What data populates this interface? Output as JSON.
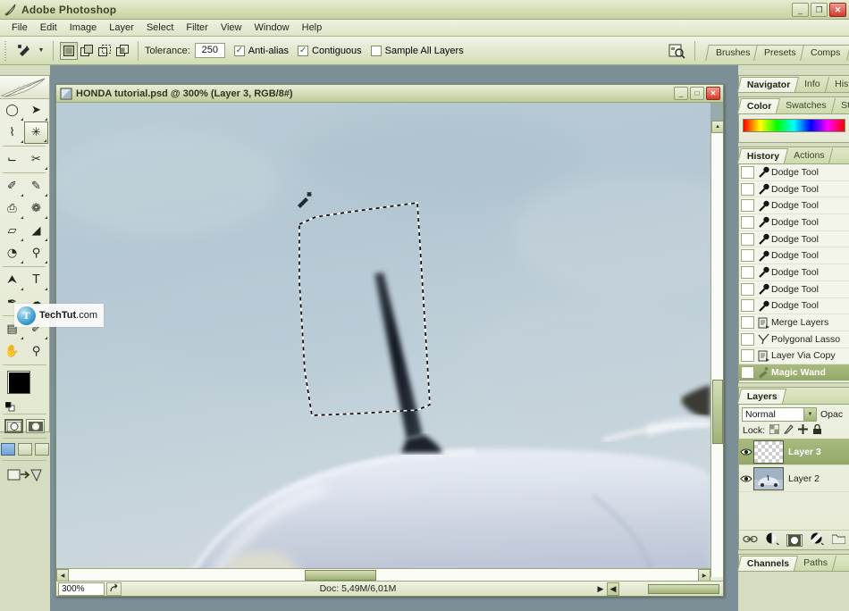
{
  "app": {
    "title": "Adobe Photoshop",
    "icon": "photoshop-feather-icon",
    "window_buttons": {
      "minimize": "_",
      "restore": "❐",
      "close": "✕"
    }
  },
  "menu": {
    "items": [
      "File",
      "Edit",
      "Image",
      "Layer",
      "Select",
      "Filter",
      "View",
      "Window",
      "Help"
    ]
  },
  "options_bar": {
    "tool_icon": "magic-wand-icon",
    "tool_preset_caret": "▼",
    "selection_modes": [
      "new-selection",
      "add-to-selection",
      "subtract-from-selection",
      "intersect-with-selection"
    ],
    "selection_mode_active": 0,
    "tolerance_label": "Tolerance:",
    "tolerance_value": "250",
    "anti_alias_label": "Anti-alias",
    "anti_alias_checked": true,
    "contiguous_label": "Contiguous",
    "contiguous_checked": true,
    "sample_all_layers_label": "Sample All Layers",
    "sample_all_layers_checked": false,
    "palette_well_tabs": [
      "Brushes",
      "Presets",
      "Comps"
    ]
  },
  "toolbox": {
    "tools": [
      {
        "name": "elliptical-marquee-tool",
        "glyph": "◯",
        "menu": true
      },
      {
        "name": "move-tool",
        "glyph": "➤",
        "menu": true
      },
      {
        "name": "lasso-tool",
        "glyph": "⌇",
        "menu": true
      },
      {
        "name": "magic-wand-tool",
        "glyph": "✳",
        "menu": true,
        "selected": true
      },
      {
        "name": "crop-tool",
        "glyph": "⌙",
        "menu": false
      },
      {
        "name": "slice-tool",
        "glyph": "✂",
        "menu": true
      },
      {
        "name": "healing-brush-tool",
        "glyph": "✐",
        "menu": true
      },
      {
        "name": "brush-tool",
        "glyph": "✎",
        "menu": true
      },
      {
        "name": "clone-stamp-tool",
        "glyph": "⎙",
        "menu": true
      },
      {
        "name": "history-brush-tool",
        "glyph": "❁",
        "menu": true
      },
      {
        "name": "eraser-tool",
        "glyph": "▱",
        "menu": true
      },
      {
        "name": "paint-bucket-tool",
        "glyph": "◢",
        "menu": true
      },
      {
        "name": "blur-tool",
        "glyph": "◔",
        "menu": true
      },
      {
        "name": "dodge-tool",
        "glyph": "⚲",
        "menu": true
      },
      {
        "name": "path-selection-tool",
        "glyph": "⮝",
        "menu": true
      },
      {
        "name": "type-tool",
        "glyph": "T",
        "menu": true
      },
      {
        "name": "pen-tool",
        "glyph": "✒",
        "menu": true
      },
      {
        "name": "custom-shape-tool",
        "glyph": "☁",
        "menu": true
      },
      {
        "name": "notes-tool",
        "glyph": "▤",
        "menu": true
      },
      {
        "name": "eyedropper-tool",
        "glyph": "✐",
        "menu": true
      },
      {
        "name": "hand-tool",
        "glyph": "✋",
        "menu": false
      },
      {
        "name": "zoom-tool",
        "glyph": "⚲",
        "menu": false
      }
    ],
    "foreground_color": "#000000",
    "background_color": "#c8ccc0",
    "quick_mask_modes": [
      "standard-mode",
      "quick-mask-mode"
    ],
    "quick_mask_active": 0,
    "screen_modes": [
      "standard-screen-mode",
      "full-screen-with-menubar",
      "full-screen-mode"
    ],
    "screen_mode_active": 0,
    "jump_to_label": "jump-to-imageready"
  },
  "watermark": {
    "logo": "T",
    "name": "TechTut",
    "suffix": ".com"
  },
  "document": {
    "icon": "psd-document-icon",
    "title": "HONDA tutorial.psd @ 300% (Layer 3, RGB/8#)",
    "window_buttons": {
      "minimize": "_",
      "maximize": "□",
      "close": "✕"
    },
    "status": {
      "zoom": "300%",
      "doc_label": "Doc: 5,49M/6,01M",
      "play_arrow": "▶",
      "left_arrow": "◀"
    },
    "image_description": "close-up of white car roof with radio antenna against sky, polygonal marching-ants selection around antenna"
  },
  "palettes": {
    "navigator_group": {
      "tabs": [
        "Navigator",
        "Info",
        "Histog"
      ],
      "active": 0
    },
    "color_group": {
      "tabs": [
        "Color",
        "Swatches",
        "Styles"
      ],
      "active": 0,
      "spectrum": "rainbow-ramp"
    },
    "history_group": {
      "tabs": [
        "History",
        "Actions"
      ],
      "active": 0
    },
    "history_items": [
      {
        "label": "Dodge Tool",
        "icon": "dodge-tool-icon"
      },
      {
        "label": "Dodge Tool",
        "icon": "dodge-tool-icon"
      },
      {
        "label": "Dodge Tool",
        "icon": "dodge-tool-icon"
      },
      {
        "label": "Dodge Tool",
        "icon": "dodge-tool-icon"
      },
      {
        "label": "Dodge Tool",
        "icon": "dodge-tool-icon"
      },
      {
        "label": "Dodge Tool",
        "icon": "dodge-tool-icon"
      },
      {
        "label": "Dodge Tool",
        "icon": "dodge-tool-icon"
      },
      {
        "label": "Dodge Tool",
        "icon": "dodge-tool-icon"
      },
      {
        "label": "Dodge Tool",
        "icon": "dodge-tool-icon"
      },
      {
        "label": "Merge Layers",
        "icon": "merge-layers-icon"
      },
      {
        "label": "Polygonal Lasso",
        "icon": "polygonal-lasso-icon"
      },
      {
        "label": "Layer Via Copy",
        "icon": "layer-via-copy-icon"
      },
      {
        "label": "Magic Wand",
        "icon": "magic-wand-icon",
        "selected": true
      }
    ],
    "layers_group": {
      "tabs": [
        "Layers"
      ],
      "active": 0
    },
    "layers_panel": {
      "blend_mode": "Normal",
      "blend_caret": "▼",
      "opacity_label": "Opac",
      "lock_label": "Lock:",
      "lock_icons": [
        "lock-transparent-pixels-icon",
        "lock-image-pixels-icon",
        "lock-position-icon",
        "lock-all-icon"
      ],
      "layers": [
        {
          "name": "Layer 3",
          "visible": true,
          "selected": true,
          "thumb": "transparent-checker"
        },
        {
          "name": "Layer 2",
          "visible": true,
          "selected": false,
          "thumb": "car-photo"
        }
      ],
      "bottom_buttons": [
        "link-layers-icon",
        "layer-style-icon",
        "layer-mask-icon",
        "adjustment-layer-icon",
        "new-group-icon"
      ]
    },
    "channels_group": {
      "tabs": [
        "Channels",
        "Paths"
      ],
      "active": 0
    }
  },
  "colors": {
    "chrome_light": "#eef2e2",
    "chrome_mid": "#d8e0ba",
    "chrome_dark": "#9aa87c",
    "selection_green": "#92a869",
    "close_red": "#d33a28",
    "desktop": "#7c8e96"
  }
}
